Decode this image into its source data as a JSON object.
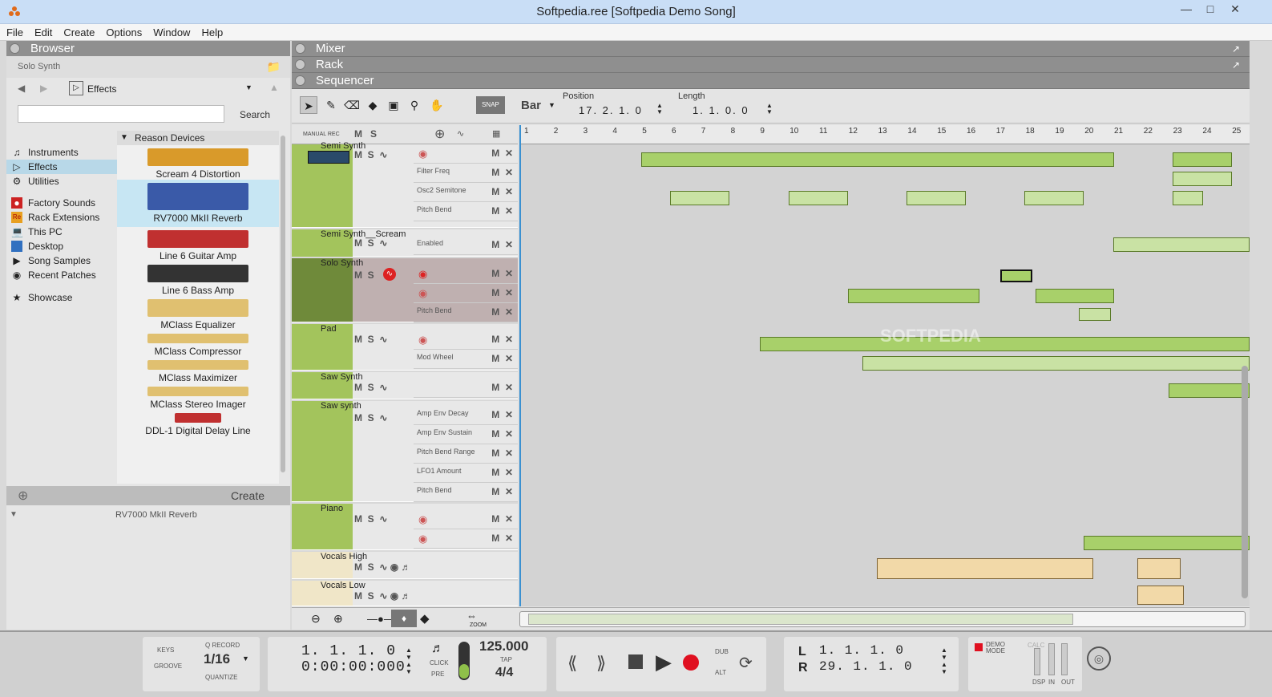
{
  "window": {
    "title": "Softpedia.ree [Softpedia Demo Song]"
  },
  "menu": [
    "File",
    "Edit",
    "Create",
    "Options",
    "Window",
    "Help"
  ],
  "browser": {
    "title": "Browser",
    "solo_label": "Solo Synth",
    "location": "Effects",
    "search_button": "Search",
    "locations": [
      {
        "label": "Instruments",
        "icon": "instruments-icon"
      },
      {
        "label": "Effects",
        "icon": "effects-icon",
        "selected": true
      },
      {
        "label": "Utilities",
        "icon": "utilities-icon"
      },
      {
        "label": "Factory Sounds",
        "icon": "factory-sounds-icon"
      },
      {
        "label": "Rack Extensions",
        "icon": "rack-extensions-icon"
      },
      {
        "label": "This PC",
        "icon": "pc-icon"
      },
      {
        "label": "Desktop",
        "icon": "desktop-icon"
      },
      {
        "label": "Song Samples",
        "icon": "song-samples-icon"
      },
      {
        "label": "Recent Patches",
        "icon": "recent-patches-icon"
      },
      {
        "label": "Showcase",
        "icon": "star-icon"
      }
    ],
    "devices_header": "Reason Devices",
    "devices": [
      {
        "label": "Scream 4 Distortion",
        "color": "#d99a2a"
      },
      {
        "label": "RV7000 MkII Reverb",
        "color": "#3a5aa8",
        "selected": true
      },
      {
        "label": "Line 6 Guitar Amp",
        "color": "#c03030"
      },
      {
        "label": "Line 6 Bass Amp",
        "color": "#333333"
      },
      {
        "label": "MClass Equalizer",
        "color": "#e0c070"
      },
      {
        "label": "MClass Compressor",
        "color": "#e0c070"
      },
      {
        "label": "MClass Maximizer",
        "color": "#e0c070"
      },
      {
        "label": "MClass Stereo Imager",
        "color": "#e0c070"
      },
      {
        "label": "DDL-1 Digital Delay Line",
        "color": "#c03030"
      }
    ],
    "create_label": "Create",
    "preview_label": "RV7000 MkII Reverb"
  },
  "panes": {
    "mixer": "Mixer",
    "rack": "Rack",
    "sequencer": "Sequencer"
  },
  "sequencer": {
    "snap": "SNAP",
    "bar": "Bar",
    "position_label": "Position",
    "position_value": "17. 2. 1. 0",
    "length_label": "Length",
    "length_value": "1. 1. 0. 0",
    "manual_rec": "MANUAL REC",
    "ruler": [
      "1",
      "2",
      "3",
      "4",
      "5",
      "6",
      "7",
      "8",
      "9",
      "10",
      "11",
      "12",
      "13",
      "14",
      "15",
      "16",
      "17",
      "18",
      "19",
      "20",
      "21",
      "22",
      "23",
      "24",
      "25"
    ],
    "tracks": [
      {
        "name": "Semi Synth",
        "lanes": [
          "",
          "Filter Freq",
          "Osc2 Semitone",
          "Pitch Bend"
        ]
      },
      {
        "name": "Semi Synth__Scream",
        "lanes": [
          "Enabled"
        ]
      },
      {
        "name": "Solo Synth",
        "lanes": [
          "",
          "",
          "Pitch Bend"
        ]
      },
      {
        "name": "Pad",
        "lanes": [
          "",
          "Mod Wheel"
        ]
      },
      {
        "name": "Saw Synth",
        "lanes": [
          ""
        ]
      },
      {
        "name": "Saw synth",
        "lanes": [
          "Amp Env Decay",
          "Amp Env Sustain",
          "Pitch Bend Range",
          "LFO1 Amount",
          "Pitch Bend"
        ]
      },
      {
        "name": "Piano",
        "lanes": [
          "",
          ""
        ]
      },
      {
        "name": "Vocals High",
        "lanes": [
          ""
        ]
      },
      {
        "name": "Vocals Low",
        "lanes": [
          ""
        ]
      }
    ],
    "zoom_label": "ZOOM"
  },
  "transport": {
    "keys": "KEYS",
    "groove": "GROOVE",
    "q_record": "Q RECORD",
    "quantize_value": "1/16",
    "quantize": "QUANTIZE",
    "song_position": "1.  1.  1.    0",
    "time": "0:00:00:000",
    "click": "CLICK",
    "pre": "PRE",
    "tempo": "125.000",
    "tap": "TAP",
    "signature": "4/4",
    "dub": "DUB",
    "alt": "ALT",
    "left_label": "L",
    "left_value": "1.  1.  1.    0",
    "right_label": "R",
    "right_value": "29.  1.  1.    0",
    "demo_mode": "DEMO MODE",
    "calc": "CALC",
    "dsp": "DSP",
    "in": "IN",
    "out": "OUT"
  }
}
